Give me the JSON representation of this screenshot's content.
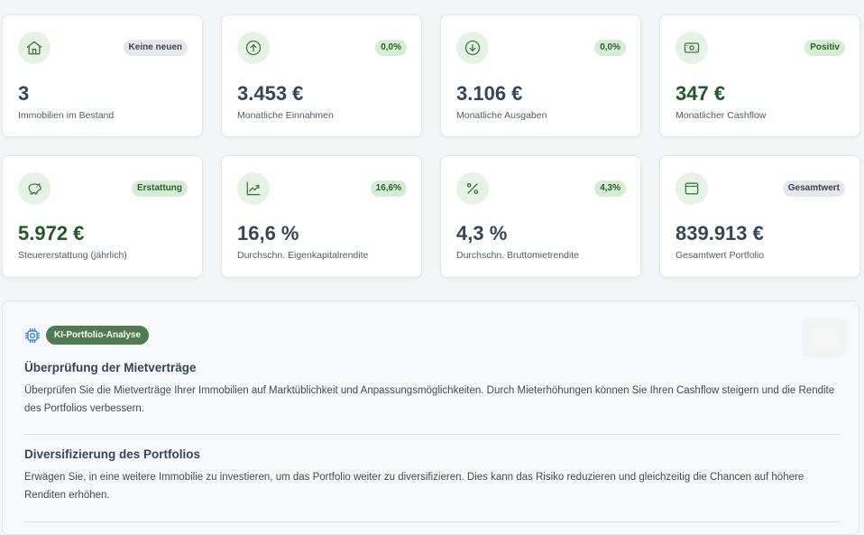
{
  "cards": [
    {
      "icon": "house-icon",
      "badge": "Keine neuen",
      "badge_style": "gray",
      "value": "3",
      "value_style": "default",
      "label": "Immobilien im Bestand"
    },
    {
      "icon": "arrow-up-circle-icon",
      "badge": "0,0%",
      "badge_style": "green",
      "value": "3.453 €",
      "value_style": "default",
      "label": "Monatliche Einnahmen"
    },
    {
      "icon": "arrow-down-circle-icon",
      "badge": "0,0%",
      "badge_style": "green",
      "value": "3.106 €",
      "value_style": "default",
      "label": "Monatliche Ausgaben"
    },
    {
      "icon": "banknote-icon",
      "badge": "Positiv",
      "badge_style": "green",
      "value": "347 €",
      "value_style": "green",
      "label": "Monatlicher Cashflow"
    },
    {
      "icon": "piggy-bank-icon",
      "badge": "Erstattung",
      "badge_style": "green",
      "value": "5.972 €",
      "value_style": "green",
      "label": "Steuererstattung (jährlich)"
    },
    {
      "icon": "trending-up-icon",
      "badge": "16,6%",
      "badge_style": "green",
      "value": "16,6 %",
      "value_style": "default",
      "label": "Durchschn. Eigenkapitalrendite"
    },
    {
      "icon": "percent-icon",
      "badge": "4,3%",
      "badge_style": "green",
      "value": "4,3 %",
      "value_style": "default",
      "label": "Durchschn. Bruttomietrendite"
    },
    {
      "icon": "wallet-icon",
      "badge": "Gesamtwert",
      "badge_style": "gray",
      "value": "839.913 €",
      "value_style": "default",
      "label": "Gesamtwert Portfolio"
    }
  ],
  "analysis": {
    "tag": "KI-Portfolio-Analyse",
    "recommendations": [
      {
        "title": "Überprüfung der Mietverträge",
        "text": "Überprüfen Sie die Mietverträge Ihrer Immobilien auf Marktüblichkeit und Anpassungsmöglichkeiten. Durch Mieterhöhungen können Sie Ihren Cashflow steigern und die Rendite des Portfolios verbessern."
      },
      {
        "title": "Diversifizierung des Portfolios",
        "text": "Erwägen Sie, in eine weitere Immobilie zu investieren, um das Portfolio weiter zu diversifizieren. Dies kann das Risiko reduzieren und gleichzeitig die Chancen auf höhere Renditen erhöhen."
      }
    ]
  },
  "colors": {
    "accent": "#4f7a52",
    "icon_bg": "#e7f2e6",
    "positive_value": "#1e5b24"
  }
}
